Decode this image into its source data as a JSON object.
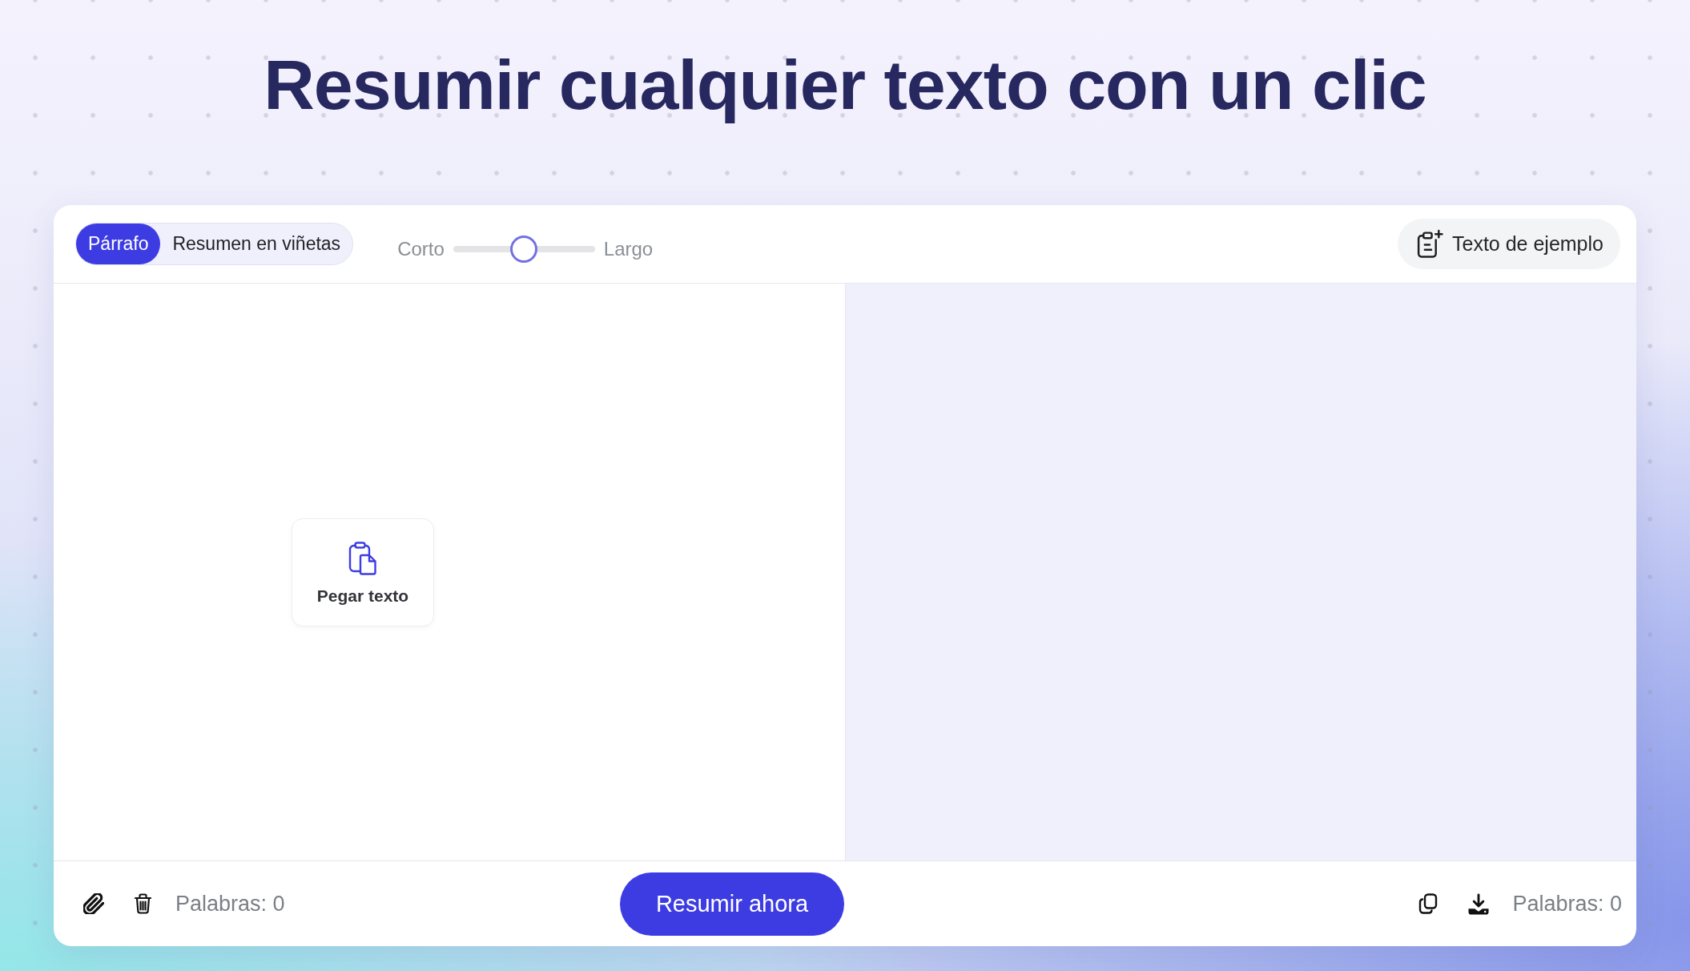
{
  "title": "Resumir cualquier texto con un clic",
  "toolbar": {
    "modes": [
      {
        "label": "Párrafo",
        "selected": true
      },
      {
        "label": "Resumen en viñetas",
        "selected": false
      }
    ],
    "length_slider": {
      "min_label": "Corto",
      "max_label": "Largo",
      "level": 0.5
    },
    "sample_button": {
      "label": "Texto de ejemplo"
    }
  },
  "input_panel": {
    "paste_button": {
      "label": "Pegar texto"
    }
  },
  "footer": {
    "input_word_count": "Palabras: 0",
    "summarize_button": {
      "label": "Resumir ahora"
    },
    "output_word_count": "Palabras: 0"
  }
}
